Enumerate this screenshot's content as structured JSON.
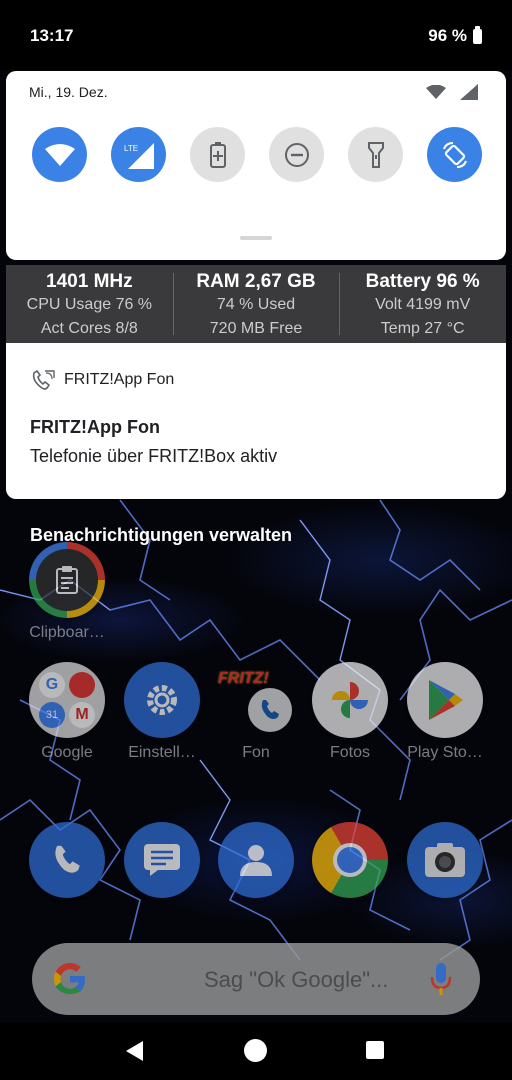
{
  "status_bar": {
    "time": "13:17",
    "battery": "96 %"
  },
  "quick_settings": {
    "date": "Mi., 19. Dez.",
    "tiles": [
      {
        "name": "wifi",
        "state": "on"
      },
      {
        "name": "mobile-data",
        "state": "on",
        "label": "LTE"
      },
      {
        "name": "battery-saver",
        "state": "off"
      },
      {
        "name": "do-not-disturb",
        "state": "off"
      },
      {
        "name": "flashlight",
        "state": "off"
      },
      {
        "name": "auto-rotate",
        "state": "on"
      }
    ]
  },
  "monitor": {
    "cpu": {
      "head": "1401 MHz",
      "line1": "CPU Usage 76 %",
      "line2": "Act Cores 8/8"
    },
    "ram": {
      "head": "RAM 2,67 GB",
      "line1": "74 % Used",
      "line2": "720 MB Free"
    },
    "battery": {
      "head": "Battery 96 %",
      "line1": "Volt 4199 mV",
      "line2": "Temp 27 °C"
    }
  },
  "notification": {
    "app_name": "FRITZ!App Fon",
    "title": "FRITZ!App Fon",
    "text": "Telefonie über FRITZ!Box aktiv"
  },
  "manage_notifications": "Benachrichtigungen verwalten",
  "home": {
    "apps_row1": [
      {
        "label": "Clipboar…",
        "icon": "clipboard-icon"
      }
    ],
    "apps_row2": [
      {
        "label": "Google",
        "icon": "google-folder-icon"
      },
      {
        "label": "Einstell…",
        "icon": "settings-icon"
      },
      {
        "label": "Fon",
        "icon": "fritz-fon-icon"
      },
      {
        "label": "Fotos",
        "icon": "photos-icon"
      },
      {
        "label": "Play Sto…",
        "icon": "play-store-icon"
      }
    ],
    "dock": [
      {
        "icon": "phone-icon"
      },
      {
        "icon": "messages-icon"
      },
      {
        "icon": "contacts-icon"
      },
      {
        "icon": "chrome-icon"
      },
      {
        "icon": "camera-icon"
      }
    ],
    "fritz_badge": "FRITZ!"
  },
  "search": {
    "placeholder": "Sag \"Ok Google\"..."
  },
  "colors": {
    "accent": "#3b82e6",
    "panel": "#ffffff",
    "monitor_bg": "#3a3a3c"
  }
}
